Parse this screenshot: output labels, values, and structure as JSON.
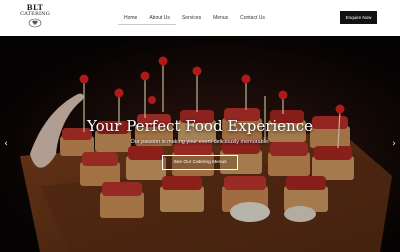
{
  "brand": {
    "name": "BLT",
    "subname": "CATERING",
    "logo_icon": "plate-heart-icon"
  },
  "nav": {
    "items": [
      {
        "label": "Home",
        "active": true
      },
      {
        "label": "About Us",
        "active": true
      },
      {
        "label": "Services",
        "active": false
      },
      {
        "label": "Menus",
        "active": false
      },
      {
        "label": "Contact Us",
        "active": false
      }
    ]
  },
  "header_cta": {
    "label": "Enquire Now"
  },
  "hero": {
    "title": "Your Perfect Food Experience",
    "subtitle": "Our passion is making your event deliciously memorable.",
    "button_label": "See Our Catering Menus",
    "prev_icon": "chevron-left-icon",
    "next_icon": "chevron-right-icon",
    "prev_glyph": "‹",
    "next_glyph": "›"
  },
  "colors": {
    "header_bg": "#ffffff",
    "cta_bg": "#111111",
    "hero_text": "#ffffff"
  }
}
